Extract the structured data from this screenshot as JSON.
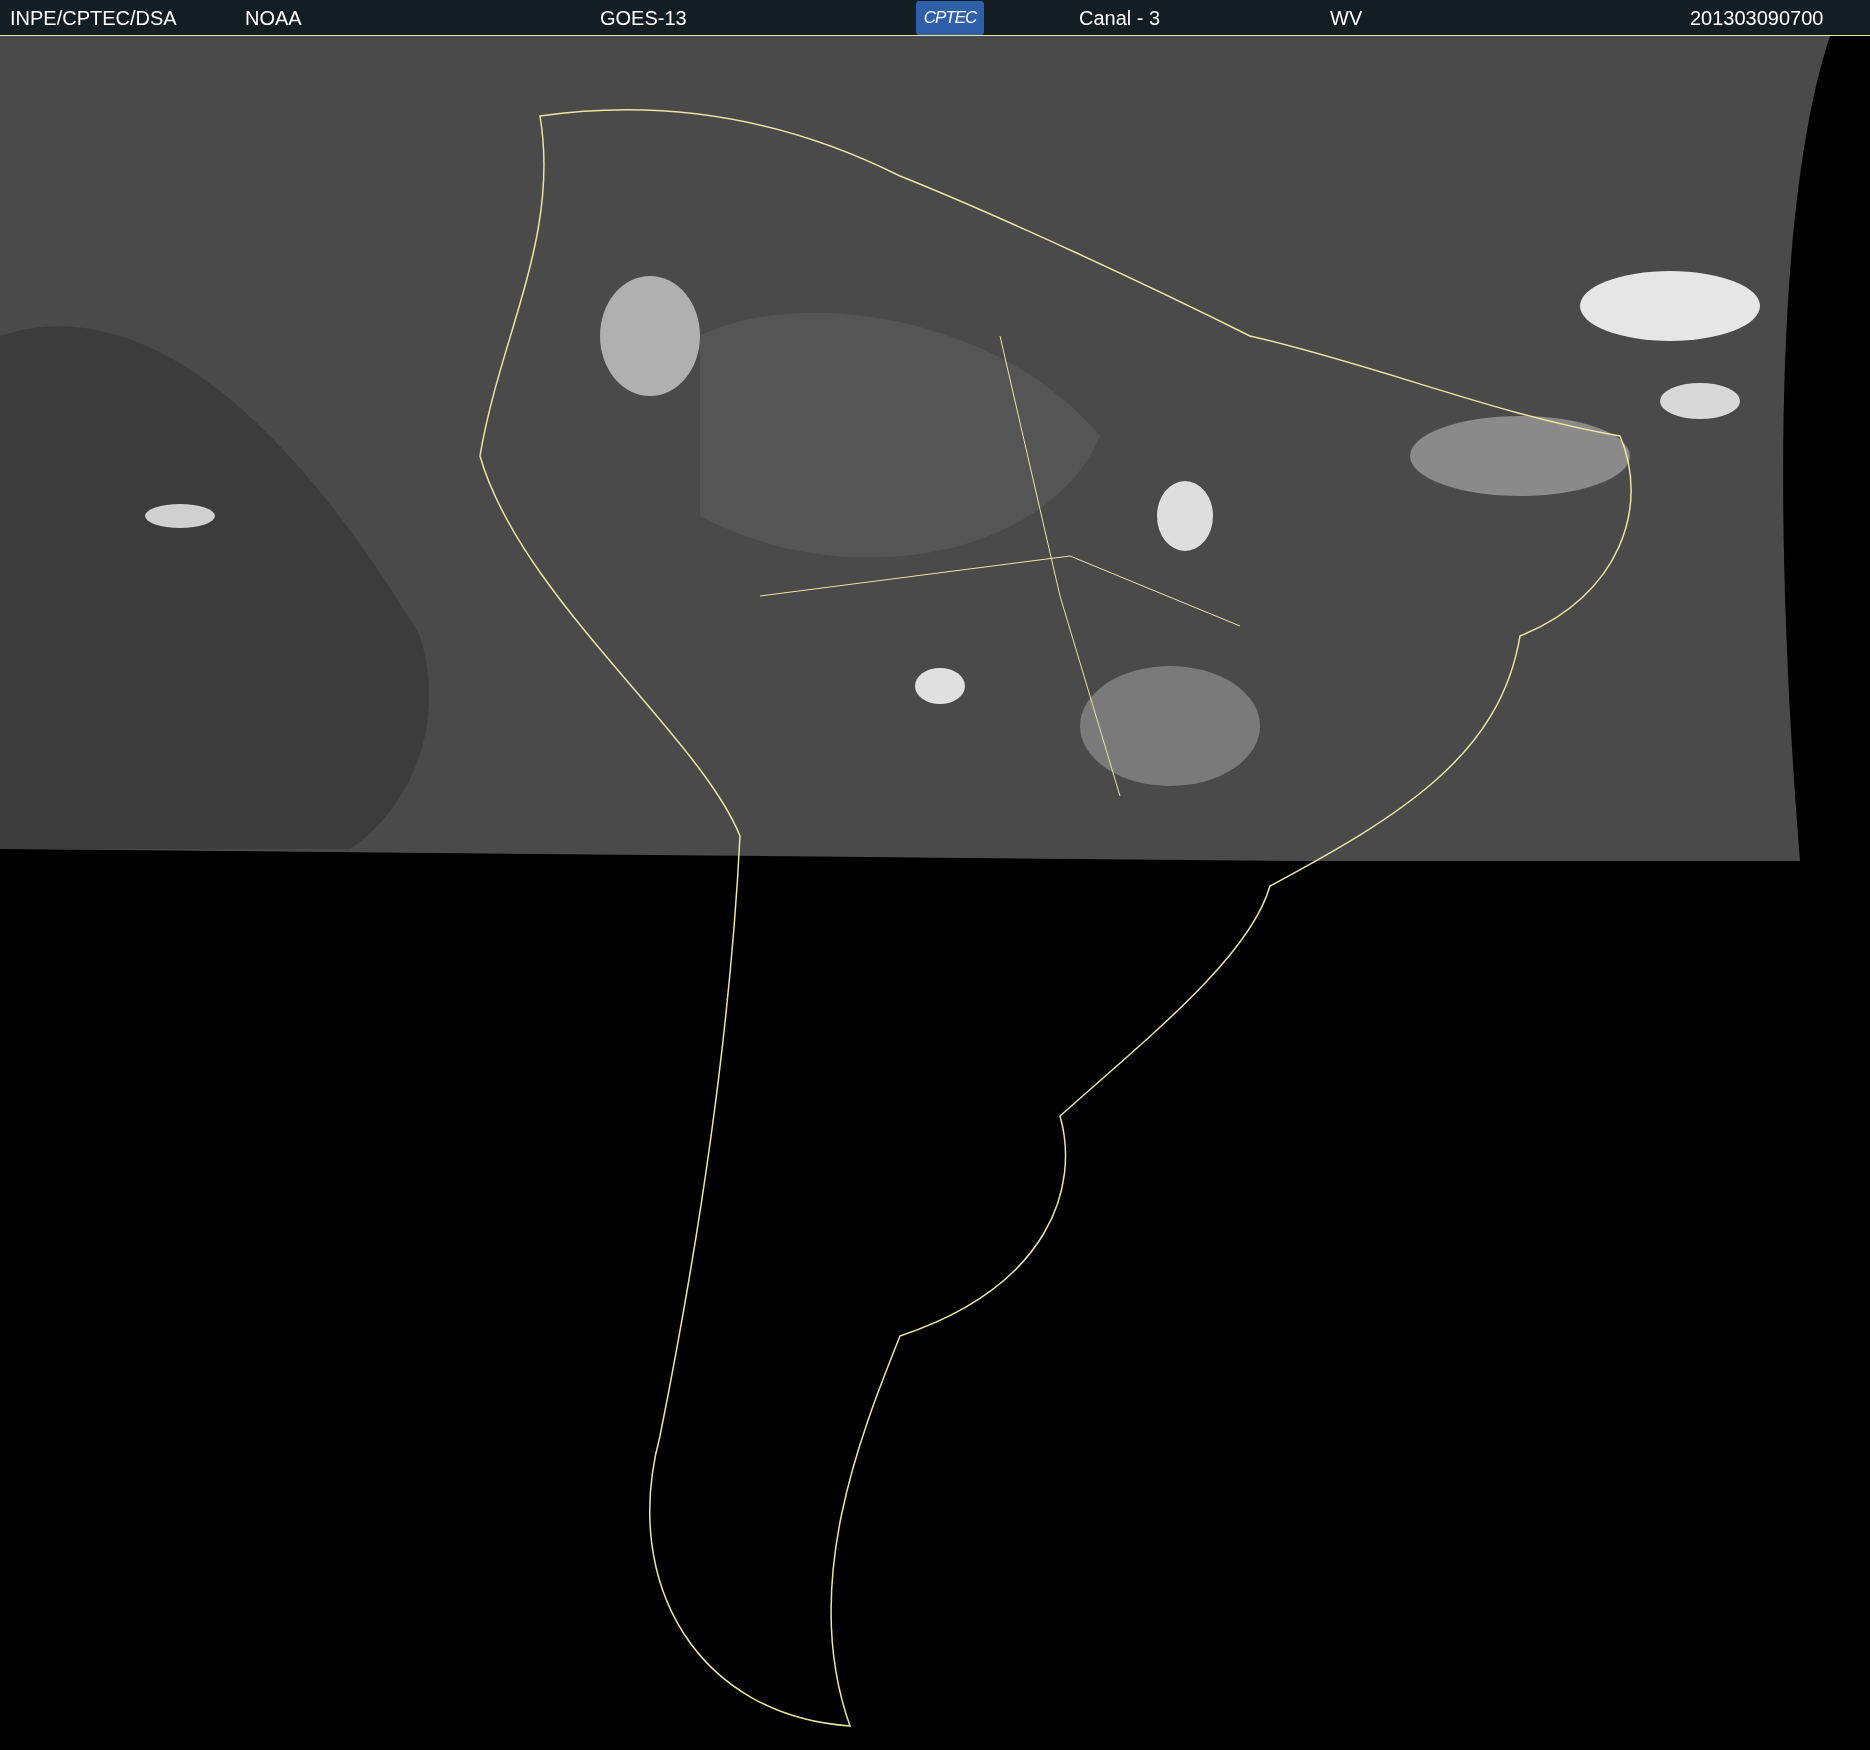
{
  "header": {
    "items": [
      {
        "kind": "text",
        "text": "INPE/CPTEC/DSA"
      },
      {
        "kind": "text",
        "text": "NOAA"
      },
      {
        "kind": "text",
        "text": "GOES-13"
      },
      {
        "kind": "logo",
        "text": "CPTEC"
      },
      {
        "kind": "text",
        "text": "Canal - 3"
      },
      {
        "kind": "text",
        "text": "WV"
      },
      {
        "kind": "text",
        "text": "201303090700"
      }
    ]
  }
}
